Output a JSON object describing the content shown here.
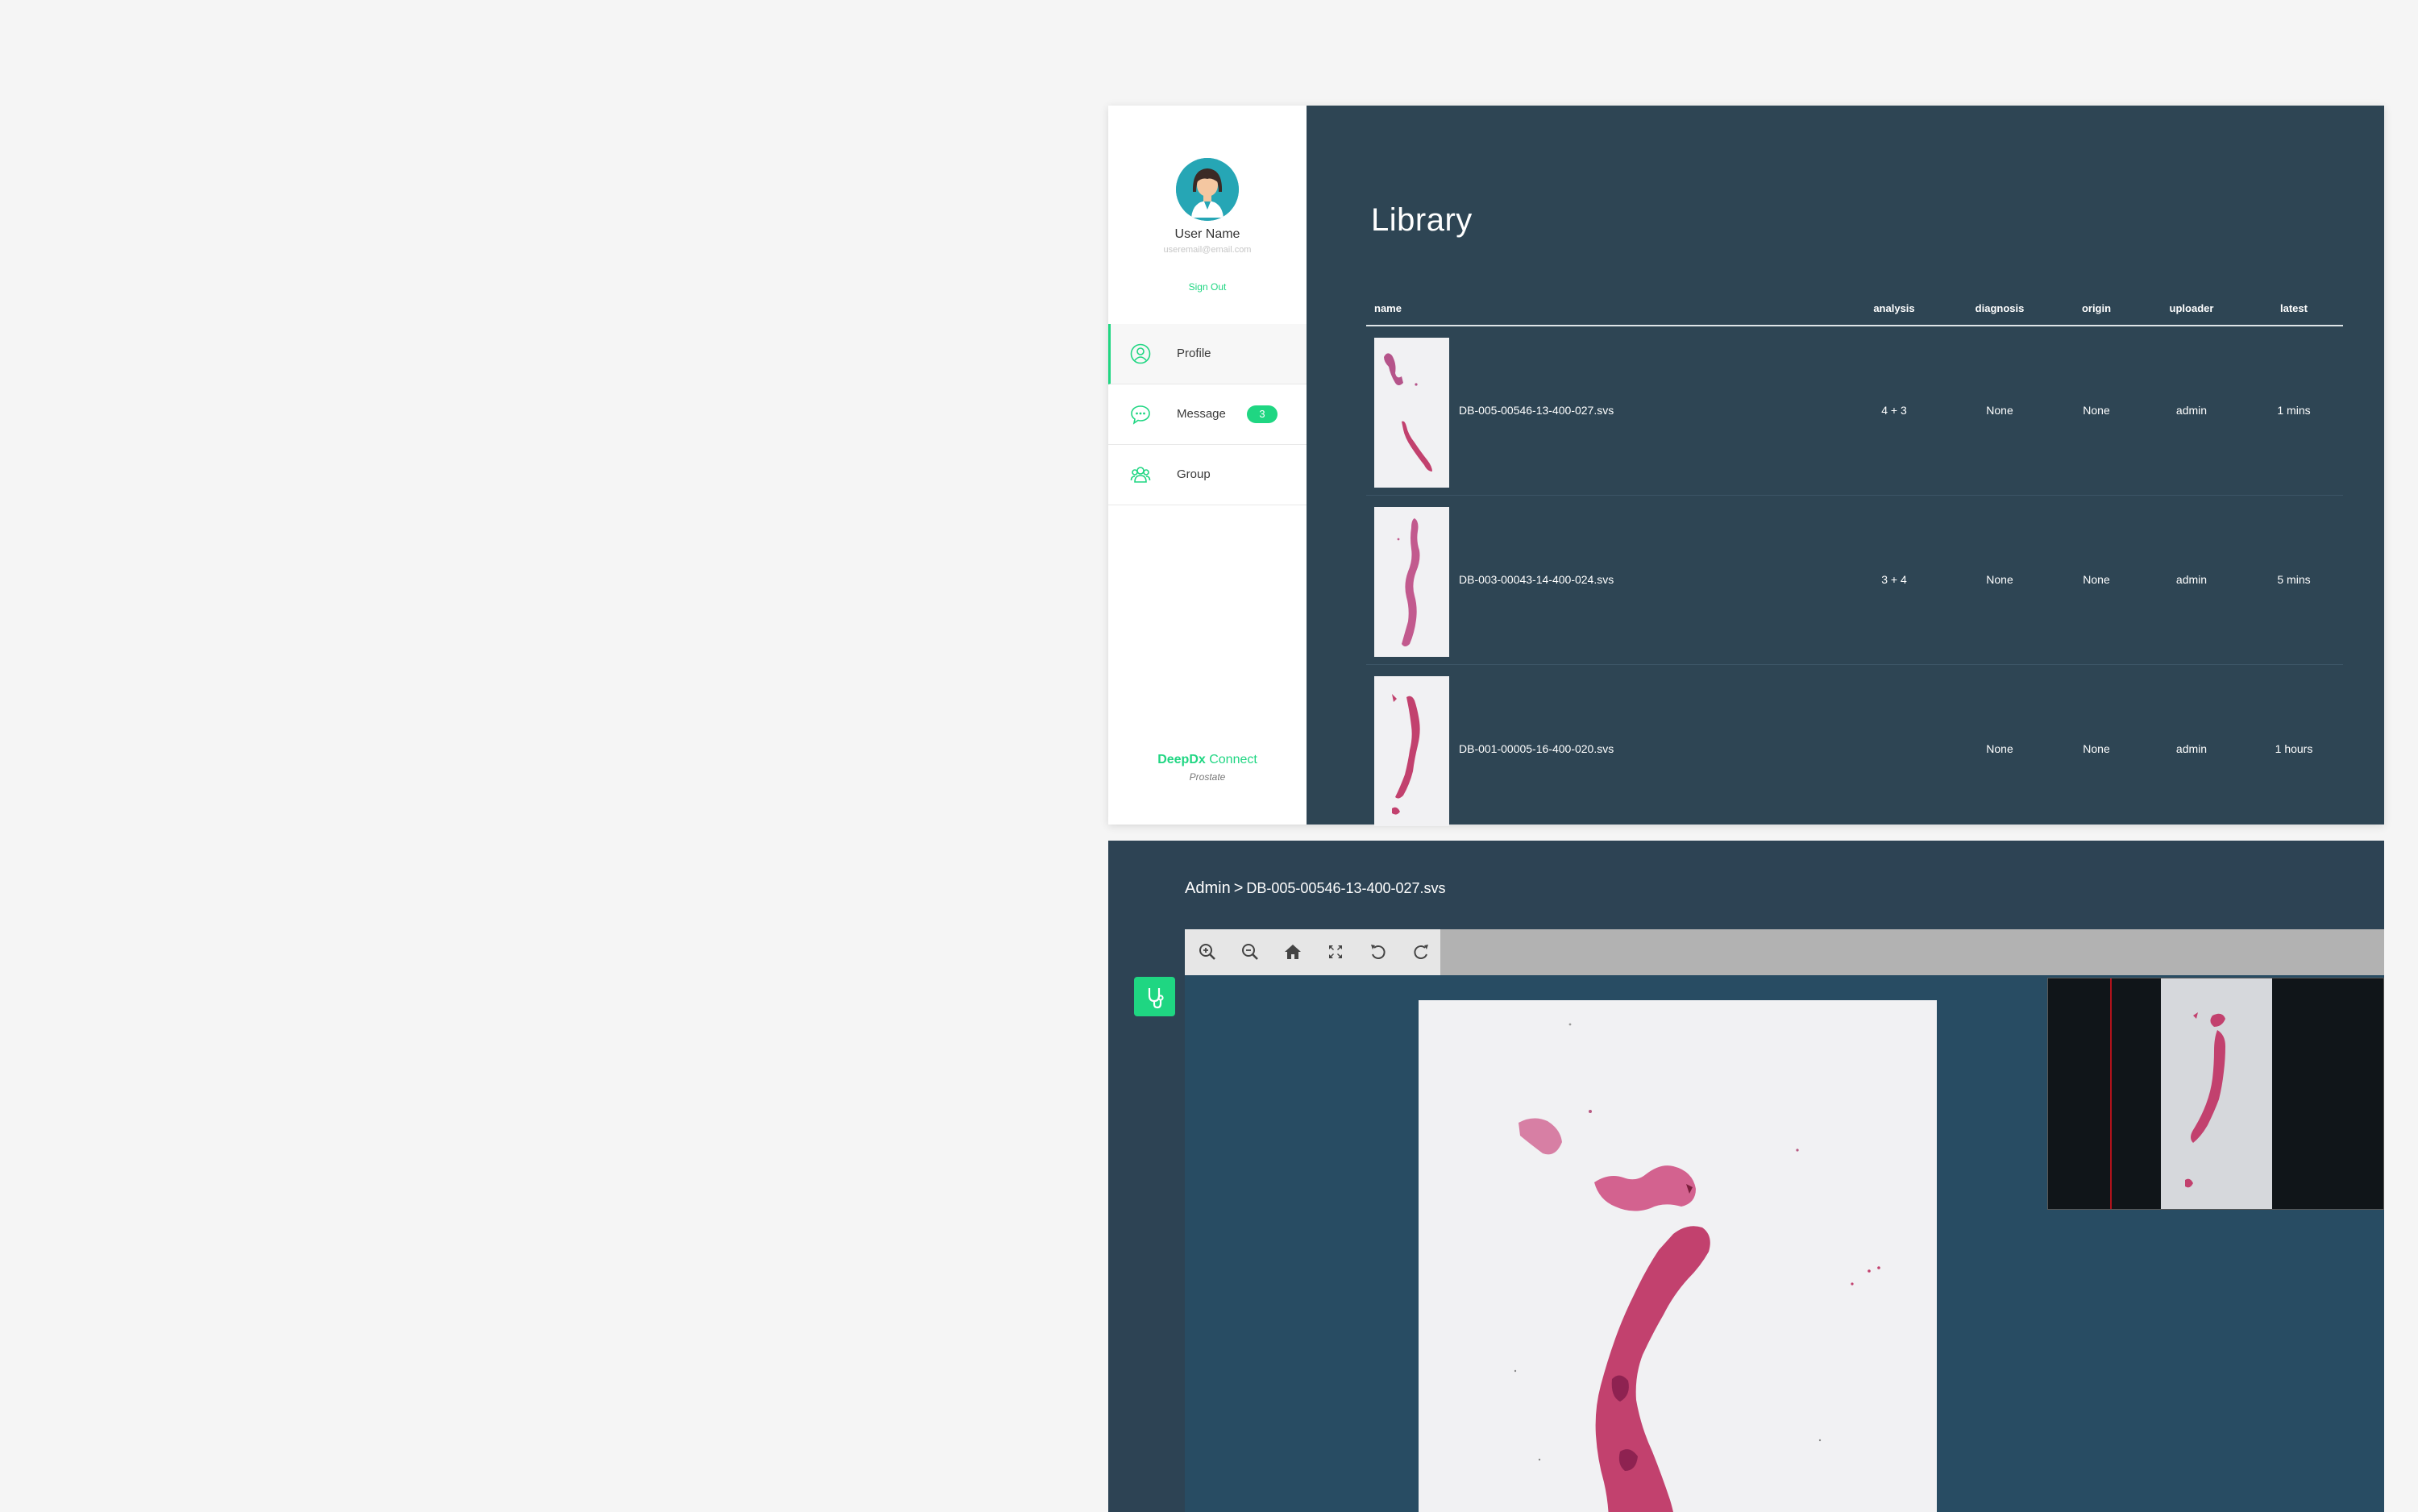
{
  "sidebar": {
    "user_name": "User Name",
    "user_email": "useremail@email.com",
    "sign_out": "Sign Out",
    "items": [
      {
        "label": "Profile",
        "icon": "user-circle-icon",
        "active": true
      },
      {
        "label": "Message",
        "icon": "chat-bubble-icon",
        "badge": "3"
      },
      {
        "label": "Group",
        "icon": "group-icon"
      }
    ],
    "brand_bold": "DeepDx",
    "brand_light": "Connect",
    "brand_sub": "Prostate"
  },
  "library": {
    "title": "Library",
    "columns": [
      "name",
      "analysis",
      "diagnosis",
      "origin",
      "uploader",
      "latest"
    ],
    "rows": [
      {
        "name": "DB-005-00546-13-400-027.svs",
        "analysis": "4 + 3",
        "diagnosis": "None",
        "origin": "None",
        "uploader": "admin",
        "latest": "1 mins"
      },
      {
        "name": "DB-003-00043-14-400-024.svs",
        "analysis": "3 + 4",
        "diagnosis": "None",
        "origin": "None",
        "uploader": "admin",
        "latest": "5 mins"
      },
      {
        "name": "DB-001-00005-16-400-020.svs",
        "analysis": "",
        "diagnosis": "None",
        "origin": "None",
        "uploader": "admin",
        "latest": "1 hours"
      }
    ]
  },
  "viewer": {
    "breadcrumb_root": "Admin",
    "breadcrumb_sep": ">",
    "breadcrumb_file": "DB-005-00546-13-400-027.svs",
    "tools": [
      "zoom-in-icon",
      "zoom-out-icon",
      "home-icon",
      "fullscreen-icon",
      "rotate-left-icon",
      "rotate-right-icon"
    ],
    "side_tool_icon": "stethoscope-icon"
  },
  "colors": {
    "accent": "#1fd682",
    "panel_bg": "#2e4554",
    "viewer_bg": "#284c63",
    "tissue": "#c2416e"
  }
}
